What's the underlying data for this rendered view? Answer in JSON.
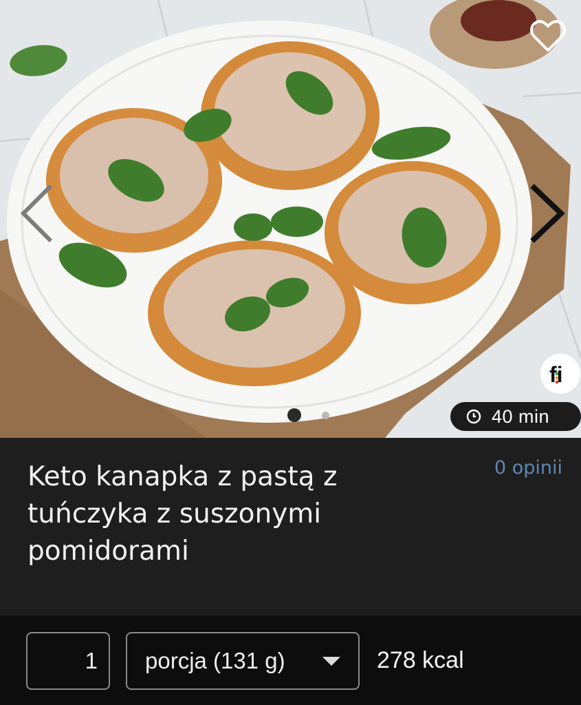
{
  "hero": {
    "image_alt": "Keto kanapka z pastą z tuńczyka z suszonymi pomidorami",
    "favorite_icon": "heart-outline-icon",
    "prev_icon": "chevron-left-icon",
    "next_icon": "chevron-right-icon",
    "carousel": {
      "count": 2,
      "active_index": 0
    },
    "brand_icon": "fi-logo-icon",
    "time_label": "40 min"
  },
  "recipe": {
    "title": "Keto kanapka z pastą z tuńczyka z suszonymi pomidorami",
    "reviews_label": "0 opinii"
  },
  "portion": {
    "quantity": "1",
    "unit_selected": "porcja (131 g)",
    "calories": "278 kcal"
  },
  "colors": {
    "background": "#1e1e1e",
    "portion_bar": "#0d0d0d",
    "link": "#5f88b3"
  }
}
